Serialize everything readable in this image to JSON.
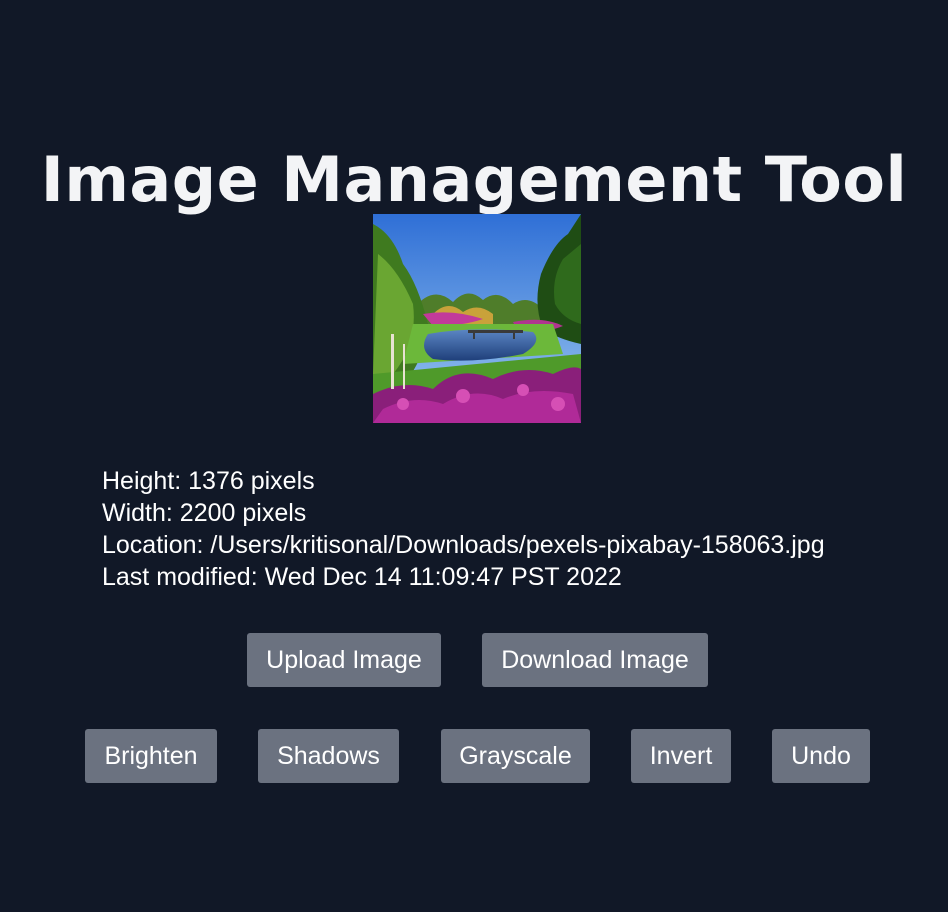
{
  "header": {
    "title": "Image Management Tool"
  },
  "image_preview": {
    "description_icon": "landscape-photo"
  },
  "info": {
    "height": "Height: 1376 pixels",
    "width": "Width: 2200 pixels",
    "location": "Location: /Users/kritisonal/Downloads/pexels-pixabay-158063.jpg",
    "last_modified": "Last modified: Wed Dec 14 11:09:47 PST 2022"
  },
  "actions": {
    "upload_label": "Upload Image",
    "download_label": "Download Image"
  },
  "filters": {
    "brighten_label": "Brighten",
    "shadows_label": "Shadows",
    "grayscale_label": "Grayscale",
    "invert_label": "Invert",
    "undo_label": "Undo"
  },
  "colors": {
    "background": "#111827",
    "button": "#6b7280",
    "text": "#ffffff"
  }
}
